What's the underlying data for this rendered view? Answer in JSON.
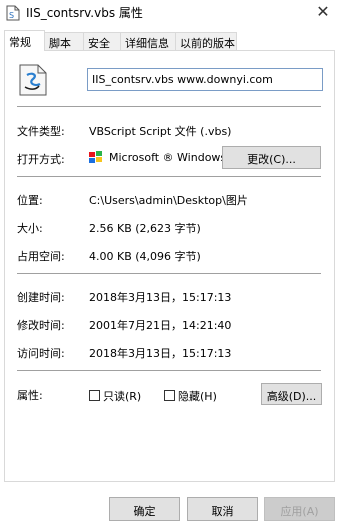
{
  "window": {
    "title": "IIS_contsrv.vbs 属性",
    "close_glyph": "✕"
  },
  "tabs": [
    {
      "label": "常规",
      "active": true
    },
    {
      "label": "脚本",
      "active": false
    },
    {
      "label": "安全",
      "active": false
    },
    {
      "label": "详细信息",
      "active": false
    },
    {
      "label": "以前的版本",
      "active": false
    }
  ],
  "general": {
    "file_name": "IIS_contsrv.vbs www.downyi.com",
    "file_type_label": "文件类型:",
    "file_type_value": "VBScript Script 文件 (.vbs)",
    "opens_with_label": "打开方式:",
    "opens_with_value": "Microsoft ® Windows",
    "change_button": "更改(C)...",
    "location_label": "位置:",
    "location_value": "C:\\Users\\admin\\Desktop\\图片",
    "size_label": "大小:",
    "size_value": "2.56 KB (2,623 字节)",
    "size_on_disk_label": "占用空间:",
    "size_on_disk_value": "4.00 KB (4,096 字节)",
    "created_label": "创建时间:",
    "created_value": "2018年3月13日，15:17:13",
    "modified_label": "修改时间:",
    "modified_value": "2001年7月21日，14:21:40",
    "accessed_label": "访问时间:",
    "accessed_value": "2018年3月13日，15:17:13",
    "attributes_label": "属性:",
    "readonly_label": "只读(R)",
    "readonly_checked": false,
    "hidden_label": "隐藏(H)",
    "hidden_checked": false,
    "advanced_button": "高级(D)..."
  },
  "footer": {
    "ok_button": "确定",
    "cancel_button": "取消",
    "apply_button": "应用(A)"
  },
  "colors": {
    "namebox_border": "#7a9cc6",
    "button_bg": "#e1e1e1",
    "disabled_text": "#a0a0a0"
  }
}
